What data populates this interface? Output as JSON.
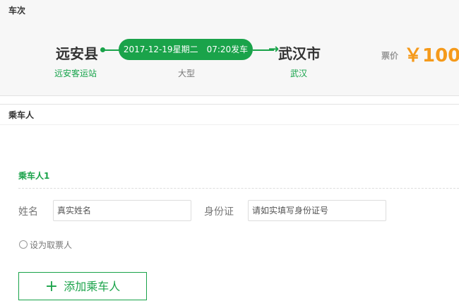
{
  "trip": {
    "section_title": "车次",
    "origin_city": "远安县",
    "origin_station": "远安客运站",
    "departure": "2017-12-19星期二　07:20发车",
    "bus_type": "大型",
    "destination_city": "武汉市",
    "destination_station": "武汉",
    "price_label": "票价",
    "price": "￥100",
    "accent_color": "#1aa34a",
    "price_color": "#f59a1b"
  },
  "passengers": {
    "section_title": "乘车人",
    "passenger_title": "乘车人1",
    "name_label": "姓名",
    "name_placeholder": "真实姓名",
    "id_label": "身份证",
    "id_placeholder": "请如实填写身份证号",
    "ticket_taker_label": "设为取票人",
    "add_button_label": "添加乘车人"
  }
}
